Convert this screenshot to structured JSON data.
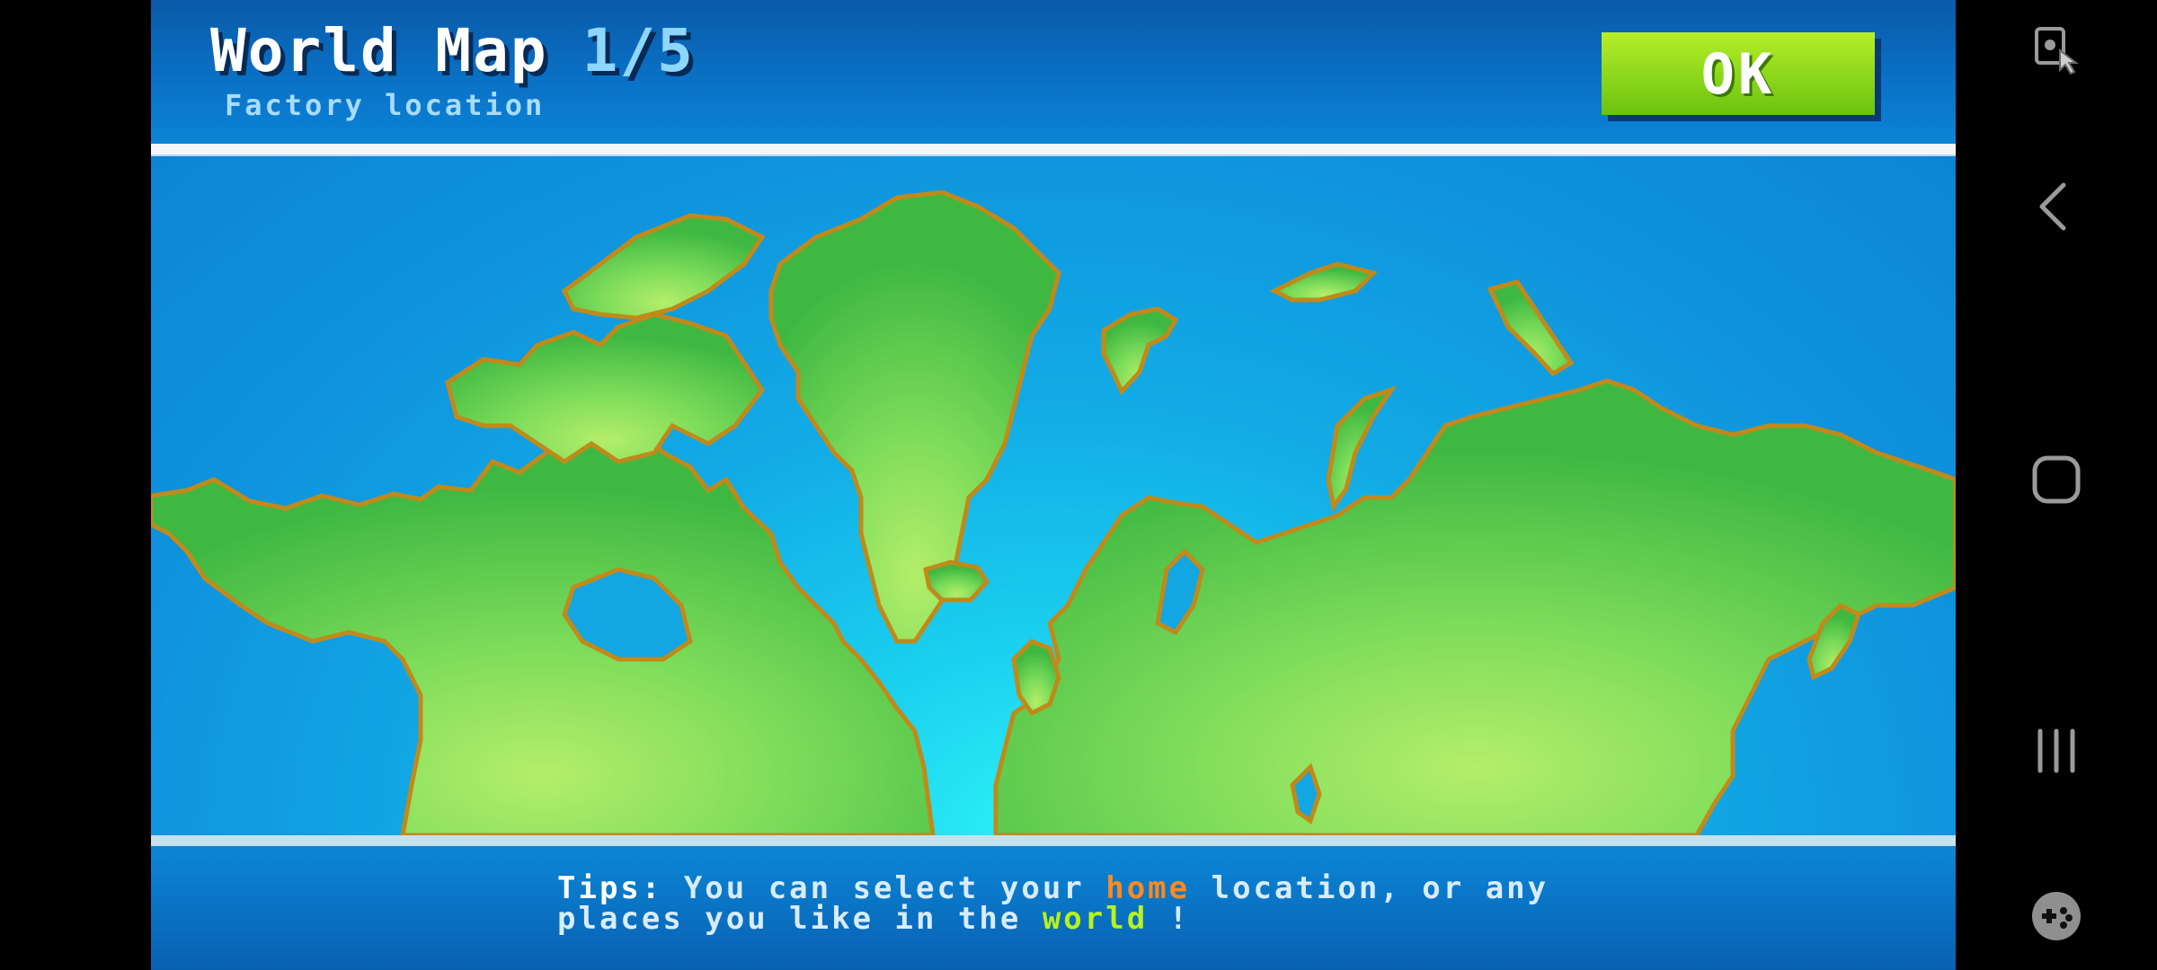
{
  "header": {
    "title": "World Map",
    "step": "1/5",
    "subtitle": "Factory location",
    "ok_label": "OK"
  },
  "footer": {
    "tips_label": "Tips:",
    "tips_part1": " You can select your ",
    "tips_home": "home",
    "tips_part2": " location, or any",
    "tips_line2_pre": "places you like in the ",
    "tips_world": "world",
    "tips_line2_post": " !"
  },
  "colors": {
    "ocean": "#0f92dc",
    "land": "#6ad654",
    "coast": "#c08a1a",
    "ok_button": "#8fd81c",
    "home_highlight": "#ff8a1e",
    "world_highlight": "#b6f21e"
  },
  "navbar": {
    "icons": [
      "screen-pin-icon",
      "back-icon",
      "home-icon",
      "recents-icon",
      "game-launcher-icon"
    ]
  }
}
